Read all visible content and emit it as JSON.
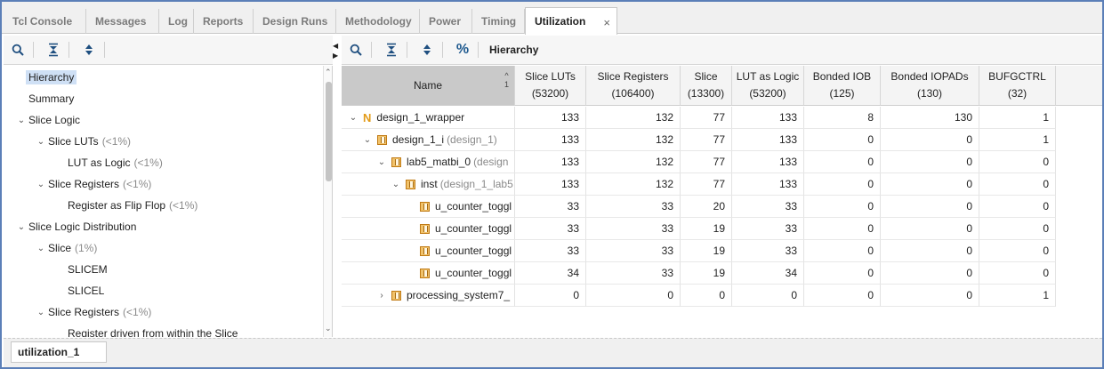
{
  "tabs": [
    {
      "label": "Tcl Console"
    },
    {
      "label": "Messages"
    },
    {
      "label": "Log"
    },
    {
      "label": "Reports"
    },
    {
      "label": "Design Runs"
    },
    {
      "label": "Methodology"
    },
    {
      "label": "Power"
    },
    {
      "label": "Timing"
    },
    {
      "label": "Utilization",
      "active": true
    }
  ],
  "tab_close_glyph": "×",
  "left_toolbar": {
    "icons": [
      "search-icon",
      "collapse-all-icon",
      "expand-all-icon"
    ]
  },
  "right_toolbar": {
    "icons": [
      "search-icon",
      "collapse-all-icon",
      "expand-all-icon",
      "percent-icon"
    ],
    "percent_glyph": "%",
    "view_label": "Hierarchy"
  },
  "tree": [
    {
      "label": "Hierarchy",
      "selected": true
    },
    {
      "label": "Summary"
    },
    {
      "label": "Slice Logic",
      "expander": "⌄"
    },
    {
      "label": "Slice LUTs",
      "suffix": "(<1%)",
      "expander": "⌄"
    },
    {
      "label": "LUT as Logic",
      "suffix": "(<1%)"
    },
    {
      "label": "Slice Registers",
      "suffix": "(<1%)",
      "expander": "⌄"
    },
    {
      "label": "Register as Flip Flop",
      "suffix": "(<1%)"
    },
    {
      "label": "Slice Logic Distribution",
      "expander": "⌄"
    },
    {
      "label": "Slice",
      "suffix": "(1%)",
      "expander": "⌄"
    },
    {
      "label": "SLICEM"
    },
    {
      "label": "SLICEL"
    },
    {
      "label": "Slice Registers",
      "suffix": "(<1%)",
      "expander": "⌄"
    },
    {
      "label": "Register driven from within the Slice"
    }
  ],
  "table": {
    "headers": [
      {
        "line1": "Name",
        "line2": ""
      },
      {
        "line1": "Slice LUTs",
        "line2": "(53200)"
      },
      {
        "line1": "Slice Registers",
        "line2": "(106400)"
      },
      {
        "line1": "Slice",
        "line2": "(13300)"
      },
      {
        "line1": "LUT as Logic",
        "line2": "(53200)"
      },
      {
        "line1": "Bonded IOB",
        "line2": "(125)"
      },
      {
        "line1": "Bonded IOPADs",
        "line2": "(130)"
      },
      {
        "line1": "BUFGCTRL",
        "line2": "(32)"
      }
    ],
    "sort": {
      "arrow": "^",
      "index": "1"
    },
    "rows": [
      {
        "name": "design_1_wrapper",
        "suffix": "",
        "icon": "N",
        "expander": "⌄",
        "values": [
          "133",
          "132",
          "77",
          "133",
          "8",
          "130",
          "1"
        ]
      },
      {
        "name": "design_1_i",
        "suffix": "(design_1)",
        "icon": "inst",
        "expander": "⌄",
        "values": [
          "133",
          "132",
          "77",
          "133",
          "0",
          "0",
          "1"
        ]
      },
      {
        "name": "lab5_matbi_0",
        "suffix": "(design",
        "icon": "inst",
        "expander": "⌄",
        "values": [
          "133",
          "132",
          "77",
          "133",
          "0",
          "0",
          "0"
        ]
      },
      {
        "name": "inst",
        "suffix": "(design_1_lab5",
        "icon": "inst",
        "expander": "⌄",
        "values": [
          "133",
          "132",
          "77",
          "133",
          "0",
          "0",
          "0"
        ]
      },
      {
        "name": "u_counter_toggl",
        "suffix": "",
        "icon": "inst",
        "expander": "",
        "values": [
          "33",
          "33",
          "20",
          "33",
          "0",
          "0",
          "0"
        ]
      },
      {
        "name": "u_counter_toggl",
        "suffix": "",
        "icon": "inst",
        "expander": "",
        "values": [
          "33",
          "33",
          "19",
          "33",
          "0",
          "0",
          "0"
        ]
      },
      {
        "name": "u_counter_toggl",
        "suffix": "",
        "icon": "inst",
        "expander": "",
        "values": [
          "33",
          "33",
          "19",
          "33",
          "0",
          "0",
          "0"
        ]
      },
      {
        "name": "u_counter_toggl",
        "suffix": "",
        "icon": "inst",
        "expander": "",
        "values": [
          "34",
          "33",
          "19",
          "34",
          "0",
          "0",
          "0"
        ]
      },
      {
        "name": "processing_system7_",
        "suffix": "",
        "icon": "inst",
        "expander": "›",
        "values": [
          "0",
          "0",
          "0",
          "0",
          "0",
          "0",
          "1"
        ]
      }
    ]
  },
  "bottom_tab": {
    "label": "utilization_1"
  }
}
